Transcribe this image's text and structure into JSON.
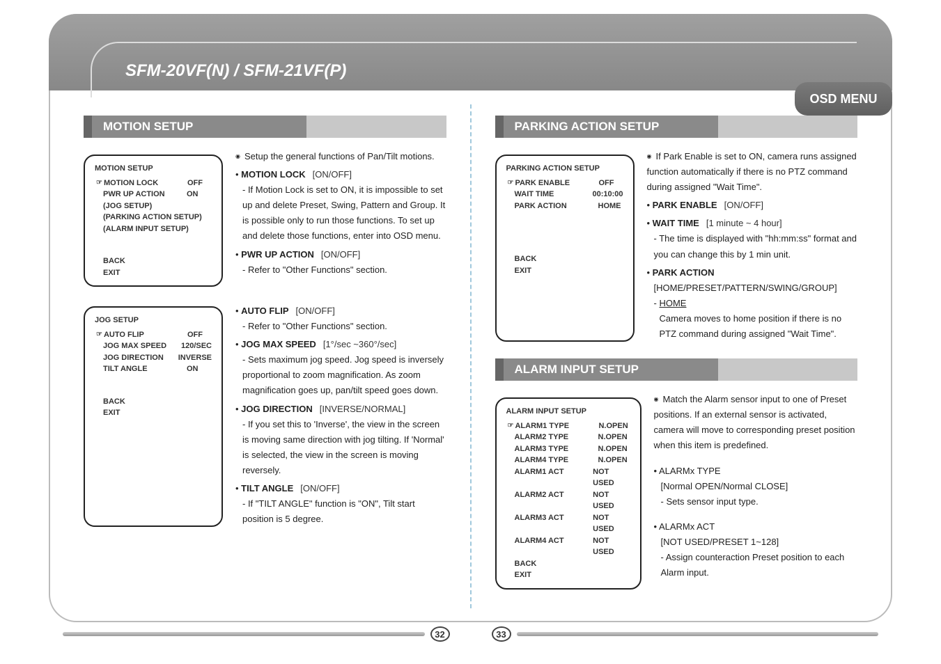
{
  "header": {
    "title": "SFM-20VF(N) / SFM-21VF(P)",
    "badge": "OSD MENU"
  },
  "pages": {
    "left": "32",
    "right": "33"
  },
  "left": {
    "sectionA": {
      "title": "MOTION SETUP",
      "osd1": {
        "title": "MOTION SETUP",
        "motionLock": "MOTION LOCK",
        "motionLockV": "OFF",
        "pwrUp": "PWR UP ACTION",
        "pwrUpV": "ON",
        "jogSetup": "(JOG SETUP)",
        "parking": "(PARKING ACTION SETUP)",
        "alarm": "(ALARM INPUT SETUP)",
        "back": "BACK",
        "exit": "EXIT"
      },
      "desc1": {
        "lead": "Setup the general functions of Pan/Tilt motions.",
        "mlock": "MOTION LOCK",
        "mlockOpt": "[ON/OFF]",
        "mlockSub": "- If Motion Lock is set to ON, it is impossible to set up and delete Preset, Swing, Pattern and Group. It is possible only to run those functions. To set up and delete those functions, enter into OSD menu.",
        "pwr": "PWR UP ACTION",
        "pwrOpt": "[ON/OFF]",
        "pwrSub": "- Refer to \"Other Functions\" section."
      },
      "osd2": {
        "title": "JOG SETUP",
        "autoFlip": "AUTO FLIP",
        "autoFlipV": "OFF",
        "jogMax": "JOG MAX SPEED",
        "jogMaxV": "120/SEC",
        "jogDir": "JOG DIRECTION",
        "jogDirV": "INVERSE",
        "tilt": "TILT ANGLE",
        "tiltV": "ON",
        "back": "BACK",
        "exit": "EXIT"
      },
      "desc2": {
        "flip": "AUTO FLIP",
        "flipOpt": "[ON/OFF]",
        "flipSub": "- Refer to \"Other Functions\" section.",
        "jmax": "JOG MAX SPEED",
        "jmaxOpt": "[1°/sec ~360°/sec]",
        "jmaxSub": "- Sets maximum jog speed. Jog speed is inversely proportional to zoom magnification. As zoom magnification goes up, pan/tilt speed goes down.",
        "jdir": "JOG DIRECTION",
        "jdirOpt": "[INVERSE/NORMAL]",
        "jdirSub": "- If you set this to 'Inverse', the view in the screen is moving same direction with jog tilting. If 'Normal' is selected, the view in the screen is moving reversely.",
        "tilt": "TILT ANGLE",
        "tiltOpt": "[ON/OFF]",
        "tiltSub": "- If \"TILT ANGLE\" function is \"ON\", Tilt start position is 5 degree."
      }
    }
  },
  "right": {
    "sectionB": {
      "title": "PARKING ACTION SETUP",
      "osd": {
        "title": "PARKING ACTION SETUP",
        "pe": "PARK ENABLE",
        "peV": "OFF",
        "wt": "WAIT TIME",
        "wtV": "00:10:00",
        "pa": "PARK ACTION",
        "paV": "HOME",
        "back": "BACK",
        "exit": "EXIT"
      },
      "desc": {
        "lead": "If Park Enable is set to ON, camera runs assigned function automatically if there is no PTZ command during assigned \"Wait Time\".",
        "pe": "PARK ENABLE",
        "peOpt": "[ON/OFF]",
        "wt": "WAIT TIME",
        "wtOpt": "[1 minute ~ 4 hour]",
        "wtSub": "- The time is displayed with \"hh:mm:ss\" format and you can change this by 1 min unit.",
        "pa": "PARK ACTION",
        "paOpt": "[HOME/PRESET/PATTERN/SWING/GROUP]",
        "home": "HOME",
        "homeSub": "Camera moves to home position if there is no PTZ command during assigned \"Wait Time\"."
      }
    },
    "sectionC": {
      "title": "ALARM INPUT SETUP",
      "osd": {
        "title": "ALARM INPUT SETUP",
        "a1t": "ALARM1 TYPE",
        "a1tV": "N.OPEN",
        "a2t": "ALARM2 TYPE",
        "a2tV": "N.OPEN",
        "a3t": "ALARM3 TYPE",
        "a3tV": "N.OPEN",
        "a4t": "ALARM4 TYPE",
        "a4tV": "N.OPEN",
        "a1a": "ALARM1 ACT",
        "a1aV": "NOT USED",
        "a2a": "ALARM2 ACT",
        "a2aV": "NOT USED",
        "a3a": "ALARM3 ACT",
        "a3aV": "NOT USED",
        "a4a": "ALARM4 ACT",
        "a4aV": "NOT USED",
        "back": "BACK",
        "exit": "EXIT"
      },
      "desc": {
        "lead": "Match the Alarm sensor input to one of Preset positions. If an external sensor is activated, camera will move to corresponding preset position when this item is predefined.",
        "atype": "• ALARMx TYPE",
        "atypeOpt": "[Normal OPEN/Normal CLOSE]",
        "atypeSub": "- Sets sensor input type.",
        "aact": "• ALARMx ACT",
        "aactOpt": "[NOT USED/PRESET 1~128]",
        "aactSub": "- Assign counteraction Preset position to each Alarm input."
      }
    }
  }
}
